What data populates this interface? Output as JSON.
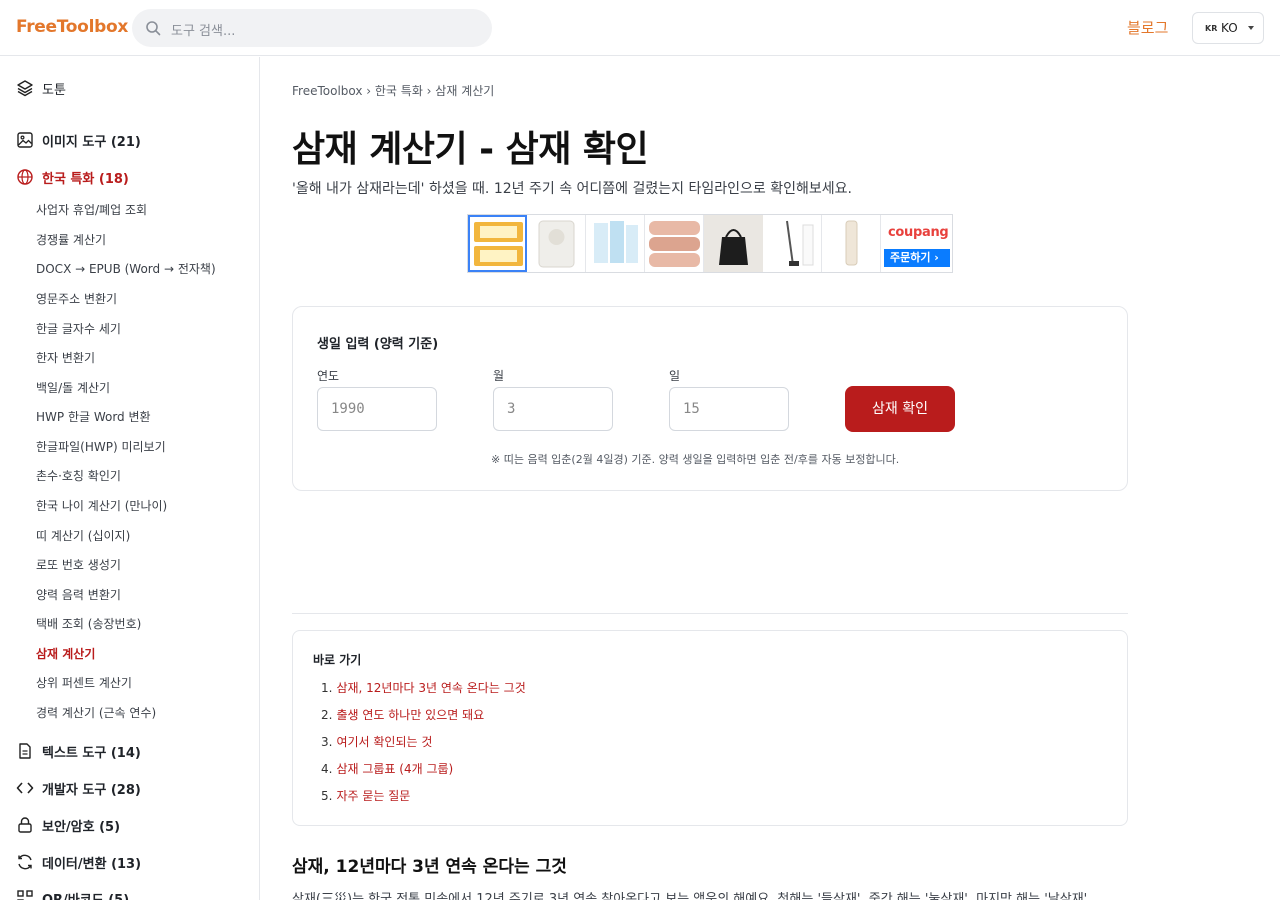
{
  "header": {
    "logo": "FreeToolbox",
    "search_placeholder": "도구 검색...",
    "blog": "블로그",
    "lang_flag": "KR",
    "lang_code": "KO"
  },
  "sidebar": {
    "top_item": "도툰",
    "categories": {
      "image": "이미지 도구 (21)",
      "korea": "한국 특화 (18)",
      "text": "텍스트 도구 (14)",
      "dev": "개발자 도구 (28)",
      "security": "보안/암호 (5)",
      "data": "데이터/변환 (13)",
      "qr": "QR/바코드 (5)"
    },
    "korea_items": [
      "사업자 휴업/폐업 조회",
      "경쟁률 계산기",
      "DOCX → EPUB (Word → 전자책)",
      "영문주소 변환기",
      "한글 글자수 세기",
      "한자 변환기",
      "백일/돌 계산기",
      "HWP 한글 Word 변환",
      "한글파일(HWP) 미리보기",
      "촌수·호칭 확인기",
      "한국 나이 계산기 (만나이)",
      "띠 계산기 (십이지)",
      "로또 번호 생성기",
      "양력 음력 변환기",
      "택배 조회 (송장번호)",
      "삼재 계산기",
      "상위 퍼센트 계산기",
      "경력 계산기 (근속 연수)"
    ]
  },
  "main": {
    "breadcrumb": "FreeToolbox › 한국 특화 › 삼재 계산기",
    "title": "삼재 계산기 - 삼재 확인",
    "subtitle": "'올해 내가 삼재라는데' 하셨을 때. 12년 주기 속 어디쯤에 걸렸는지 타임라인으로 확인해보세요.",
    "ad": {
      "brand": "coupang",
      "cta": "주문하기 ›"
    },
    "form": {
      "title": "생일 입력 (양력 기준)",
      "year_label": "연도",
      "year_placeholder": "1990",
      "month_label": "월",
      "month_placeholder": "3",
      "day_label": "일",
      "day_placeholder": "15",
      "submit": "삼재 확인",
      "note": "※ 띠는 음력 입춘(2월 4일경) 기준. 양력 생일을 입력하면 입춘 전/후를 자동 보정합니다."
    },
    "toc": {
      "title": "바로 가기",
      "items": [
        "삼재, 12년마다 3년 연속 온다는 그것",
        "출생 연도 하나만 있으면 돼요",
        "여기서 확인되는 것",
        "삼재 그룹표 (4개 그룹)",
        "자주 묻는 질문"
      ]
    },
    "section_title": "삼재, 12년마다 3년 연속 온다는 그것",
    "section_text": "삼재(三災)는 한국 전통 민속에서 12년 주기로 3년 연속 찾아온다고 보는 액운의 해예요. 첫해는 '들삼재', 중간 해는 '눌삼재', 마지막 해는 '날삼재'"
  }
}
